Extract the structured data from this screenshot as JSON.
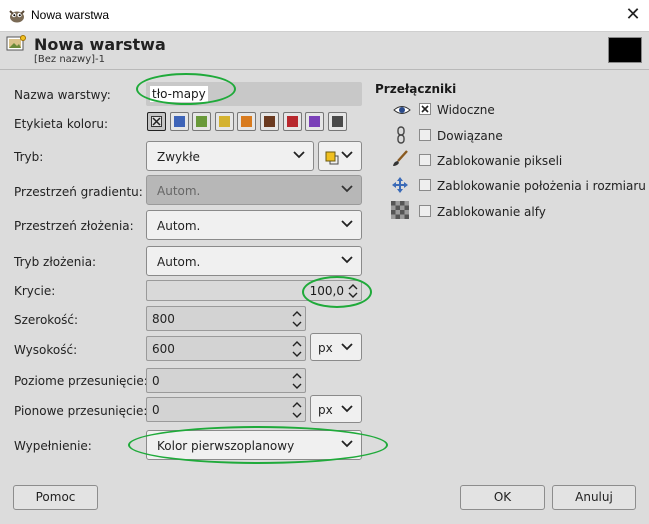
{
  "window": {
    "title": "Nowa warstwa",
    "close_symbol": "✕"
  },
  "header": {
    "title": "Nowa warstwa",
    "subtitle": "[Bez nazwy]-1",
    "fg_color": "#000000"
  },
  "form": {
    "name_label": "Nazwa warstwy:",
    "name_value": "tło-mapy",
    "color_tag_label": "Etykieta koloru:",
    "color_tags": [
      "#a0a0a0",
      "#3e64b8",
      "#6a9a3a",
      "#d4b230",
      "#d87b1f",
      "#6b3a20",
      "#b8282e",
      "#7a40b8",
      "#4a4a4a"
    ],
    "mode_label": "Tryb:",
    "mode_value": "Zwykłe",
    "gradient_space_label": "Przestrzeń gradientu:",
    "gradient_space_value": "Autom.",
    "composite_space_label": "Przestrzeń złożenia:",
    "composite_space_value": "Autom.",
    "composite_mode_label": "Tryb złożenia:",
    "composite_mode_value": "Autom.",
    "opacity_label": "Krycie:",
    "opacity_value": "100,0",
    "width_label": "Szerokość:",
    "width_value": "800",
    "height_label": "Wysokość:",
    "height_value": "600",
    "unit_value": "px",
    "offset_x_label": "Poziome przesunięcie:",
    "offset_x_value": "0",
    "offset_y_label": "Pionowe przesunięcie:",
    "offset_y_value": "0",
    "offset_unit_value": "px",
    "fill_label": "Wypełnienie:",
    "fill_value": "Kolor pierwszoplanowy"
  },
  "switches": {
    "title": "Przełączniki",
    "items": [
      {
        "label": "Widoczne",
        "checked": true,
        "icon": "eye-icon"
      },
      {
        "label": "Dowiązane",
        "checked": false,
        "icon": "chain-icon"
      },
      {
        "label": "Zablokowanie pikseli",
        "checked": false,
        "icon": "brush-icon"
      },
      {
        "label": "Zablokowanie położenia i rozmiaru",
        "checked": false,
        "icon": "move-icon"
      },
      {
        "label": "Zablokowanie alfy",
        "checked": false,
        "icon": "checker-icon"
      }
    ]
  },
  "buttons": {
    "help": "Pomoc",
    "ok": "OK",
    "cancel": "Anuluj"
  },
  "annotation_color": "#1faa3a"
}
